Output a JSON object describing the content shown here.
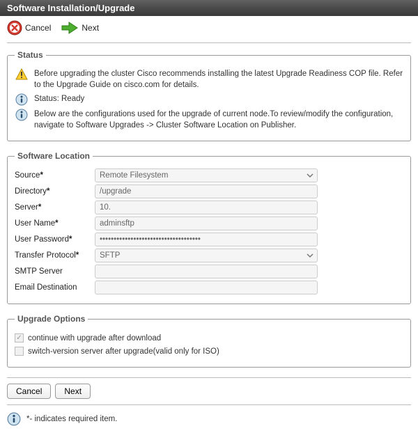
{
  "titleBar": "Software Installation/Upgrade",
  "toolbar": {
    "cancel": "Cancel",
    "next": "Next"
  },
  "status": {
    "legend": "Status",
    "warn": "Before upgrading the cluster Cisco recommends installing the latest Upgrade Readiness COP file. Refer to the Upgrade Guide on cisco.com for details.",
    "ready": "Status: Ready",
    "info2": "Below are the configurations used for the upgrade of current node.To review/modify the configuration, navigate to Software Upgrades -> Cluster Software Location on Publisher."
  },
  "location": {
    "legend": "Software Location",
    "fields": {
      "source": {
        "label": "Source",
        "value": "Remote Filesystem"
      },
      "directory": {
        "label": "Directory",
        "value": "/upgrade"
      },
      "server": {
        "label": "Server",
        "value": "10."
      },
      "user": {
        "label": "User Name",
        "value": "adminsftp"
      },
      "password": {
        "label": "User Password",
        "value": "••••••••••••••••••••••••••••••••••••"
      },
      "protocol": {
        "label": "Transfer Protocol",
        "value": "SFTP"
      },
      "smtp": {
        "label": "SMTP Server",
        "value": ""
      },
      "email": {
        "label": "Email Destination",
        "value": ""
      }
    }
  },
  "options": {
    "legend": "Upgrade Options",
    "continue": "continue with upgrade after download",
    "switch": "switch-version server after upgrade(valid only for ISO)"
  },
  "bottomButtons": {
    "cancel": "Cancel",
    "next": "Next"
  },
  "footnote": "*- indicates required item."
}
